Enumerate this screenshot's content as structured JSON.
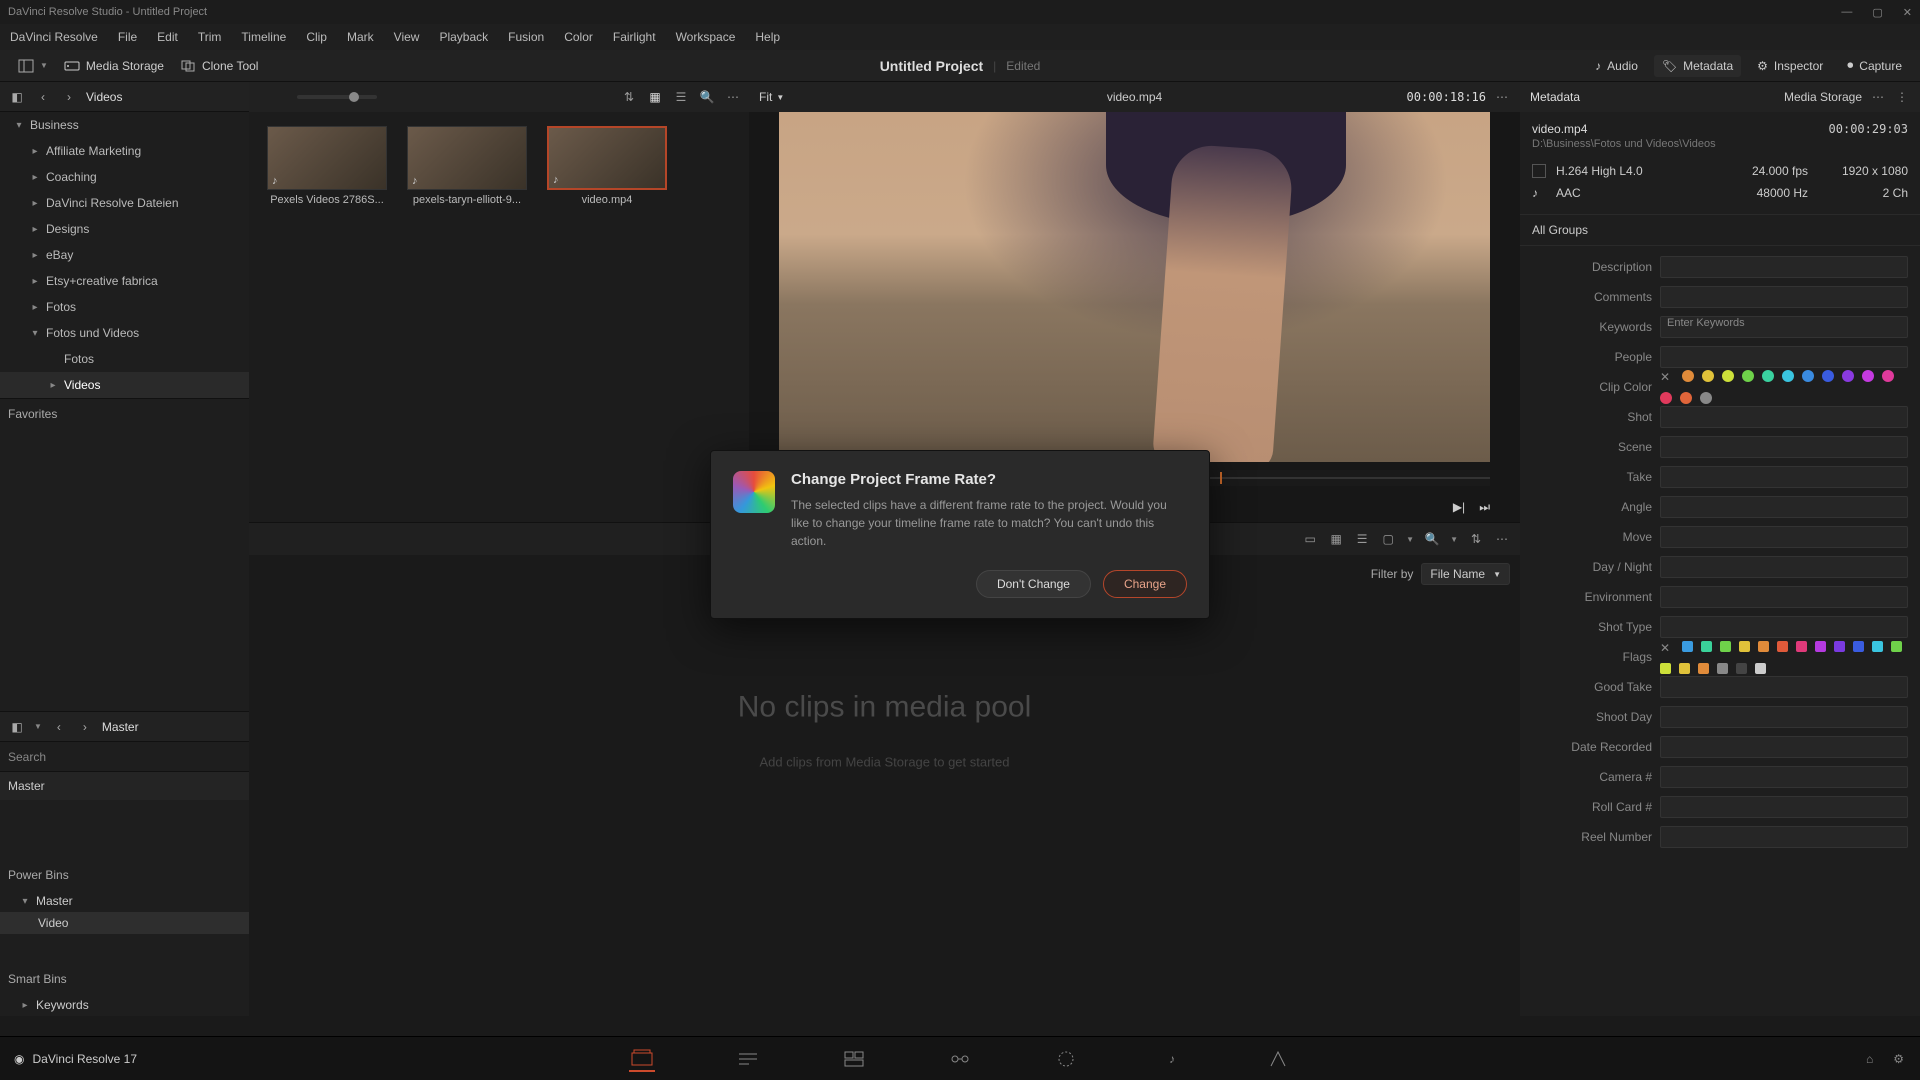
{
  "titlebar": "DaVinci Resolve Studio - Untitled Project",
  "menu": [
    "DaVinci Resolve",
    "File",
    "Edit",
    "Trim",
    "Timeline",
    "Clip",
    "Mark",
    "View",
    "Playback",
    "Fusion",
    "Color",
    "Fairlight",
    "Workspace",
    "Help"
  ],
  "toolbar": {
    "media_storage": "Media Storage",
    "clone_tool": "Clone Tool",
    "project_name": "Untitled Project",
    "project_status": "Edited",
    "audio": "Audio",
    "metadata": "Metadata",
    "inspector": "Inspector",
    "capture": "Capture"
  },
  "storage": {
    "crumb": "Videos",
    "tree": [
      {
        "label": "Business",
        "chev": "▾"
      },
      {
        "label": "Affiliate Marketing",
        "chev": "▸",
        "child": true
      },
      {
        "label": "Coaching",
        "chev": "▸",
        "child": true
      },
      {
        "label": "DaVinci Resolve Dateien",
        "chev": "▸",
        "child": true
      },
      {
        "label": "Designs",
        "chev": "▸",
        "child": true
      },
      {
        "label": "eBay",
        "chev": "▸",
        "child": true
      },
      {
        "label": "Etsy+creative fabrica",
        "chev": "▸",
        "child": true
      },
      {
        "label": "Fotos",
        "chev": "▸",
        "child": true
      },
      {
        "label": "Fotos und Videos",
        "chev": "▾",
        "child": true
      },
      {
        "label": "Fotos",
        "chev": "",
        "grandchild": true
      },
      {
        "label": "Videos",
        "chev": "▸",
        "grandchild": true,
        "selected": true
      }
    ],
    "favorites": "Favorites",
    "clips": [
      {
        "label": "Pexels Videos 2786S..."
      },
      {
        "label": "pexels-taryn-elliott-9..."
      },
      {
        "label": "video.mp4",
        "selected": true
      }
    ]
  },
  "viewer": {
    "fit": "Fit",
    "title": "video.mp4",
    "tc": "00:00:18:16"
  },
  "pool": {
    "master_crumb": "Master",
    "search_ph": "Search",
    "master": "Master",
    "power_bins": "Power Bins",
    "pb_master": "Master",
    "pb_video": "Video",
    "smart_bins": "Smart Bins",
    "keywords": "Keywords",
    "filter_label": "Filter by",
    "filter_value": "File Name",
    "empty_title": "No clips in media pool",
    "empty_sub": "Add clips from Media Storage to get started"
  },
  "meta": {
    "title": "Metadata",
    "storage": "Media Storage",
    "file": "video.mp4",
    "duration": "00:00:29:03",
    "path": "D:\\Business\\Fotos und Videos\\Videos",
    "codec": "H.264 High L4.0",
    "fps": "24.000 fps",
    "res": "1920 x 1080",
    "audio_codec": "AAC",
    "hz": "48000 Hz",
    "ch": "2 Ch",
    "groups": "All Groups",
    "fields": [
      "Description",
      "Comments",
      "Keywords",
      "People",
      "Clip Color",
      "Shot",
      "Scene",
      "Take",
      "Angle",
      "Move",
      "Day / Night",
      "Environment",
      "Shot Type",
      "Flags",
      "Good Take",
      "Shoot Day",
      "Date Recorded",
      "Camera #",
      "Roll Card #",
      "Reel Number"
    ],
    "kw_ph": "Enter Keywords",
    "clip_colors": [
      "#e08b3a",
      "#e0c23a",
      "#cde03a",
      "#6fd24a",
      "#3ad2a0",
      "#3ac5e0",
      "#3a8be0",
      "#3a5ce0",
      "#8a3ae0",
      "#c53ae0",
      "#e03a9b",
      "#e03a5c",
      "#e0653a",
      "#888"
    ],
    "flag_colors": [
      "#3a9be0",
      "#3ad29a",
      "#6fd24a",
      "#e0c23a",
      "#e08b3a",
      "#e05a3a",
      "#e03a7a",
      "#b53ae0",
      "#7a3ae0",
      "#3a5ce0",
      "#3ac5e0",
      "#6fd24a",
      "#cde03a",
      "#e0c23a",
      "#e08b3a",
      "#888",
      "#444",
      "#ccc"
    ]
  },
  "pages": {
    "home": "DaVinci Resolve 17"
  },
  "dialog": {
    "title": "Change Project Frame Rate?",
    "body": "The selected clips have a different frame rate to the project. Would you like to change your timeline frame rate to match? You can't undo this action.",
    "dont": "Don't Change",
    "change": "Change"
  }
}
